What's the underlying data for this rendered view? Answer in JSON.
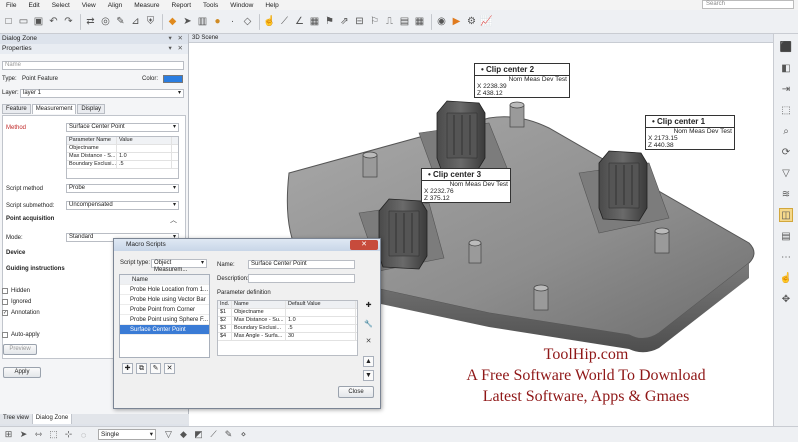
{
  "menu": {
    "items": [
      "File",
      "Edit",
      "Select",
      "View",
      "Align",
      "Measure",
      "Report",
      "Tools",
      "Window",
      "Help"
    ],
    "search_placeholder": "Search"
  },
  "left_panel": {
    "title": "Dialog Zone",
    "properties_title": "Properties",
    "name_label": "Name",
    "type_label": "Type:",
    "type_value": "Point Feature",
    "color_label": "Color:",
    "color_value": "#2a7de1",
    "layer_label": "Layer:",
    "layer_value": "layer 1",
    "tabs": [
      "Feature",
      "Measurement",
      "Display"
    ],
    "method_label": "Method",
    "method_value": "Surface Center Point",
    "param_headers": [
      "Parameter Name",
      "Value"
    ],
    "params": [
      [
        "Objectname",
        ""
      ],
      [
        "Max Distance - S...",
        "1.0"
      ],
      [
        "Boundary Exclusi...",
        ".5"
      ]
    ],
    "script_method_label": "Script method",
    "script_method_value": "Probe",
    "script_submethod_label": "Script submethod:",
    "script_submethod_value": "Uncompensated",
    "point_acquisition": "Point acquisition",
    "mode_label": "Mode:",
    "mode_value": "Standard",
    "device": "Device",
    "guiding": "Guiding instructions",
    "checks": [
      {
        "label": "Hidden",
        "checked": false
      },
      {
        "label": "Ignored",
        "checked": false
      },
      {
        "label": "Annotation",
        "checked": true
      }
    ],
    "auto_apply": "Auto-apply",
    "preview": "Preview",
    "apply": "Apply",
    "bottom_tabs": [
      "Tree view",
      "Dialog Zone"
    ]
  },
  "scene": {
    "title": "3D Scene",
    "callouts": [
      {
        "title": "Clip center 2",
        "header": "Nom Meas Dev Test",
        "x": "X 2238.39",
        "z": "Z  438.12"
      },
      {
        "title": "Clip center 1",
        "header": "Nom Meas Dev Test",
        "x": "X 2173.15",
        "z": "Z   440.38"
      },
      {
        "title": "Clip center 3",
        "header": "Nom Meas Dev Test",
        "x": "X 2232.76",
        "z": "Z   375.12"
      }
    ]
  },
  "dialog": {
    "title": "Macro Scripts",
    "script_type_label": "Script type:",
    "script_type_value": "Object Measurem...",
    "list_header": "Name",
    "items": [
      "Probe Hole Location from 1...",
      "Probe Hole using Vector Bar",
      "Probe Point from Corner",
      "Probe Point using Sphere F...",
      "Surface Center Point"
    ],
    "selected_index": 4,
    "name_label": "Name:",
    "name_value": "Surface Center Point",
    "description_label": "Description:",
    "param_def_label": "Parameter definition",
    "def_headers": [
      "Ind.",
      "Name",
      "Default Value"
    ],
    "defs": [
      [
        "$1",
        "Objectname",
        ""
      ],
      [
        "$2",
        "Max Distance - Su...",
        "1.0"
      ],
      [
        "$3",
        "Boundary Exclusi...",
        ".5"
      ],
      [
        "$4",
        "Max Angle - Surfa...",
        "30"
      ]
    ],
    "close": "Close"
  },
  "watermark": {
    "line1": "ToolHip.com",
    "line2": "A Free Software World To Download",
    "line3": "Latest Software, Apps & Gmaes"
  },
  "statusbar": {
    "mode": "Single"
  }
}
